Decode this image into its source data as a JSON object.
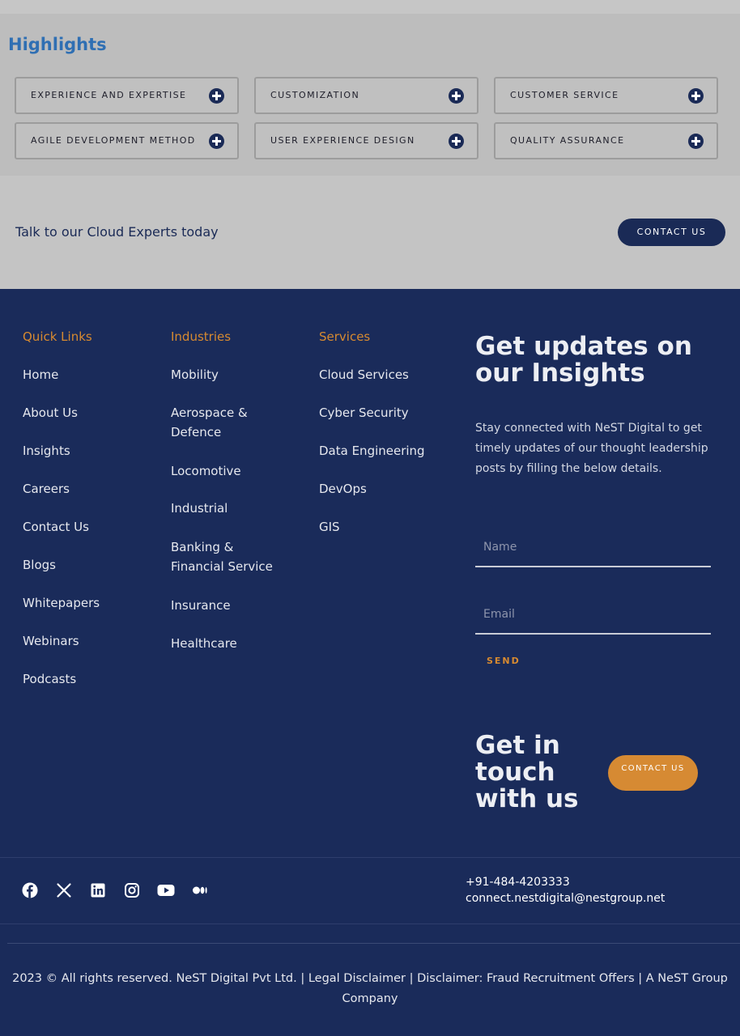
{
  "highlights": {
    "title": "Highlights",
    "items": [
      {
        "label": "EXPERIENCE AND EXPERTISE"
      },
      {
        "label": "CUSTOMIZATION"
      },
      {
        "label": "CUSTOMER SERVICE"
      },
      {
        "label": "AGILE DEVELOPMENT METHOD"
      },
      {
        "label": "USER EXPERIENCE DESIGN"
      },
      {
        "label": "QUALITY ASSURANCE"
      }
    ],
    "expand_icon": "plus-circle-icon"
  },
  "cta": {
    "text": "Talk to our Cloud Experts today",
    "button": "CONTACT US"
  },
  "footer": {
    "quick_links": {
      "heading": "Quick Links",
      "items": [
        "Home",
        "About Us",
        "Insights",
        "Careers",
        "Contact Us",
        "Blogs",
        "Whitepapers",
        "Webinars",
        "Podcasts"
      ]
    },
    "industries": {
      "heading": "Industries",
      "items": [
        "Mobility",
        "Aerospace & Defence",
        "Locomotive",
        "Industrial",
        "Banking & Financial Service",
        "Insurance",
        "Healthcare"
      ]
    },
    "services": {
      "heading": "Services",
      "items": [
        "Cloud Services",
        "Cyber Security",
        "Data Engineering",
        "DevOps",
        "GIS"
      ]
    },
    "newsletter": {
      "title": "Get updates on our Insights",
      "description": "Stay connected with NeST Digital to get timely updates of our thought leadership posts by filling the below details.",
      "name_placeholder": "Name",
      "email_placeholder": "Email",
      "send_label": "SEND"
    },
    "get_in_touch": {
      "title": "Get in touch with us",
      "button": "CONTACT US"
    },
    "social_icons": [
      "facebook-icon",
      "x-icon",
      "linkedin-icon",
      "instagram-icon",
      "youtube-icon",
      "medium-icon"
    ],
    "contact": {
      "phone": "+91-484-4203333",
      "email": "connect.nestdigital@nestgroup.net"
    },
    "copyright": "2023 © All rights reserved. NeST Digital Pvt Ltd.   |   Legal Disclaimer |   Disclaimer: Fraud Recruitment Offers   |   A NeST Group Company"
  },
  "colors": {
    "accent_orange": "#d78a30",
    "navy": "#1a2b5a",
    "highlight_title_blue": "#2f6fb3"
  }
}
